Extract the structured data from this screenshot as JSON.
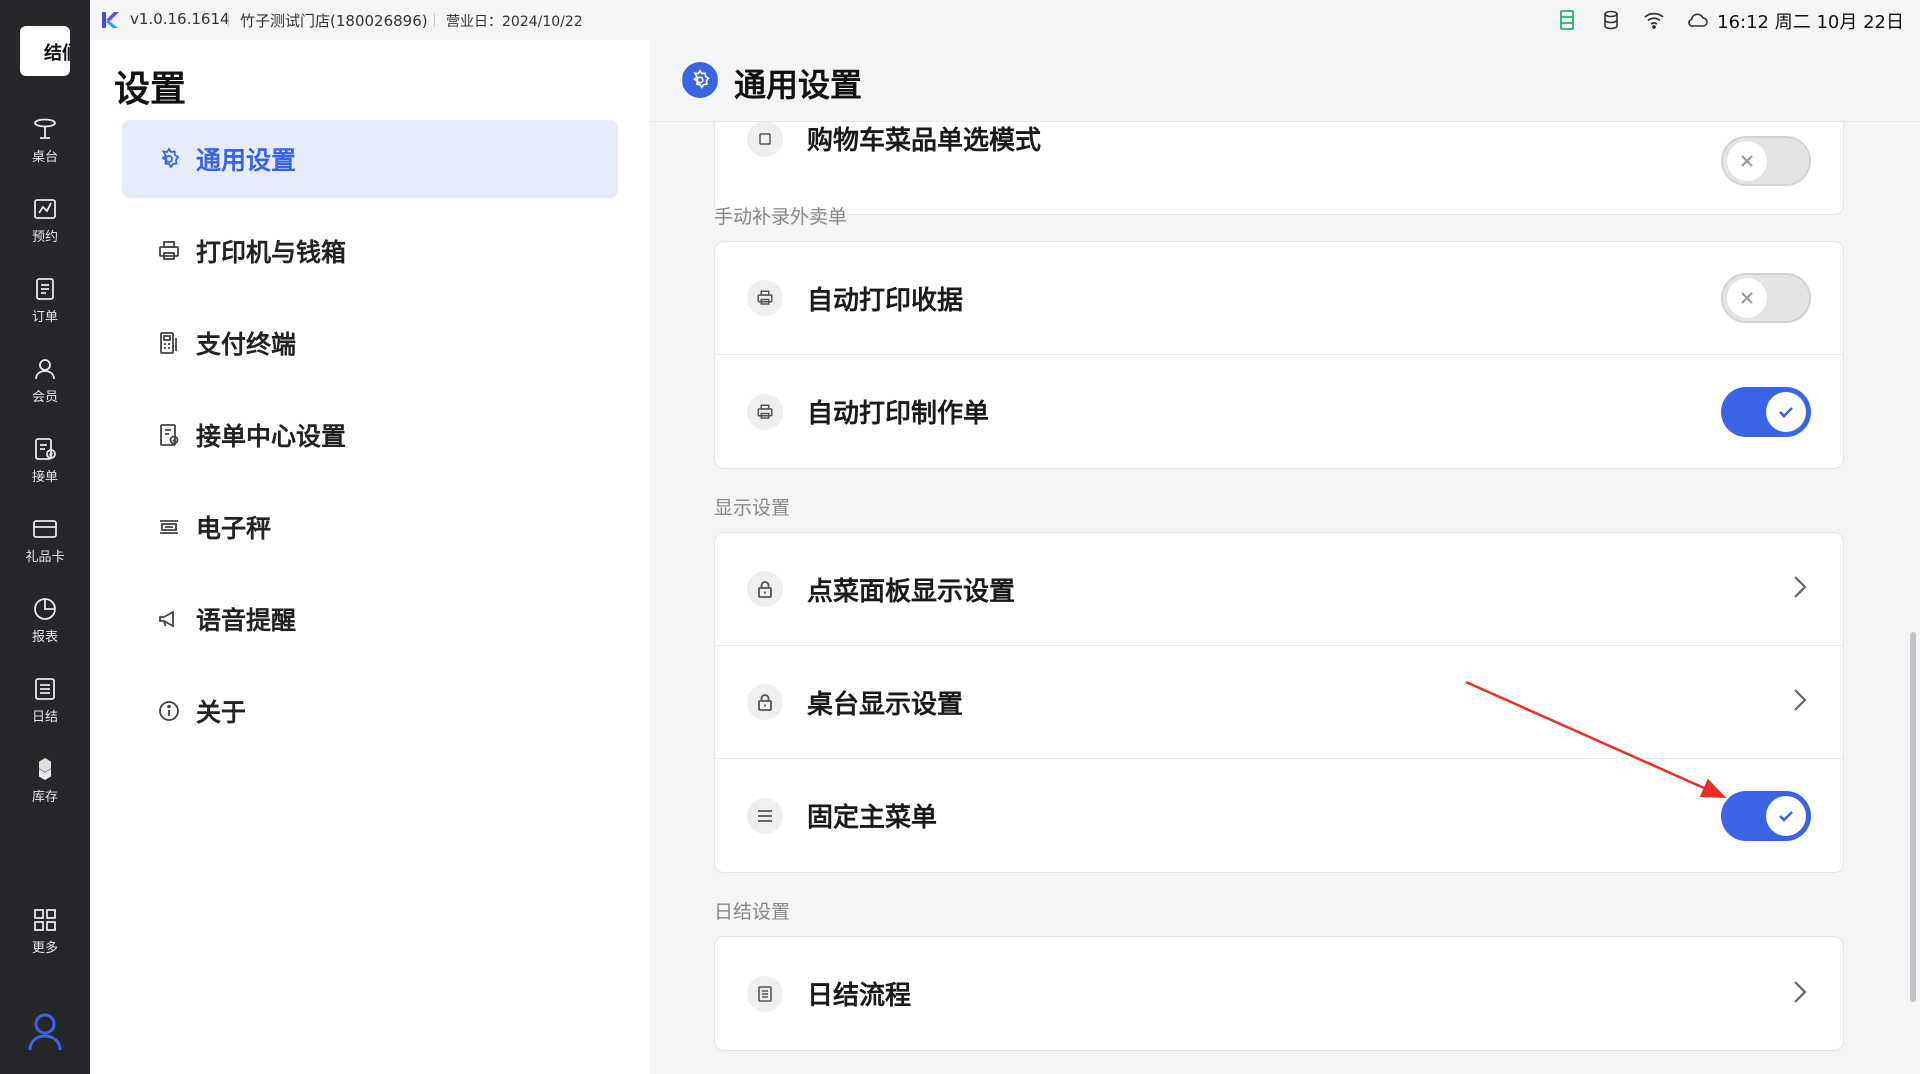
{
  "topbar": {
    "version": "v1.0.16.1614",
    "store": "竹子测试门店(180026896)",
    "business_date": "营业日：2024/10/22",
    "clock": "16:12 周二 10月 22日",
    "icons": [
      "ledger-icon",
      "database-icon",
      "wifi-icon",
      "cloud-icon"
    ],
    "accent_color": "#1fb56a"
  },
  "rail": {
    "logo_text": "结们",
    "items": [
      {
        "label": "桌台",
        "icon": "table-icon"
      },
      {
        "label": "预约",
        "icon": "reservation-icon"
      },
      {
        "label": "订单",
        "icon": "order-icon"
      },
      {
        "label": "会员",
        "icon": "member-icon"
      },
      {
        "label": "接单",
        "icon": "accept-order-icon"
      },
      {
        "label": "礼品卡",
        "icon": "gift-card-icon"
      },
      {
        "label": "报表",
        "icon": "report-icon"
      },
      {
        "label": "日结",
        "icon": "daily-close-icon"
      },
      {
        "label": "库存",
        "icon": "inventory-icon"
      },
      {
        "label": "更多",
        "icon": "more-icon"
      }
    ],
    "user_icon": "user-icon",
    "user_color": "#3b63e6"
  },
  "menu": {
    "title": "设置",
    "active_color": "#3b63e6",
    "items": [
      {
        "label": "通用设置",
        "icon": "gear-icon",
        "active": true
      },
      {
        "label": "打印机与钱箱",
        "icon": "printer-icon",
        "active": false
      },
      {
        "label": "支付终端",
        "icon": "pos-terminal-icon",
        "active": false
      },
      {
        "label": "接单中心设置",
        "icon": "order-center-icon",
        "active": false
      },
      {
        "label": "电子秤",
        "icon": "scale-icon",
        "active": false
      },
      {
        "label": "语音提醒",
        "icon": "megaphone-icon",
        "active": false
      },
      {
        "label": "关于",
        "icon": "info-icon",
        "active": false
      }
    ]
  },
  "content": {
    "title": "通用设置",
    "cut_row": {
      "label": "购物车菜品单选模式",
      "icon": "cart-icon",
      "toggle": "off"
    },
    "sections": [
      {
        "label": "手动补录外卖单",
        "rows": [
          {
            "label": "自动打印收据",
            "icon": "printer-icon",
            "control": "toggle",
            "state": "off"
          },
          {
            "label": "自动打印制作单",
            "icon": "printer-icon",
            "control": "toggle",
            "state": "on"
          }
        ]
      },
      {
        "label": "显示设置",
        "rows": [
          {
            "label": "点菜面板显示设置",
            "icon": "lock-icon",
            "control": "chevron"
          },
          {
            "label": "桌台显示设置",
            "icon": "lock-icon",
            "control": "chevron"
          },
          {
            "label": "固定主菜单",
            "icon": "menu-lines-icon",
            "control": "toggle",
            "state": "on"
          }
        ]
      },
      {
        "label": "日结设置",
        "rows": [
          {
            "label": "日结流程",
            "icon": "list-doc-icon",
            "control": "chevron"
          }
        ]
      }
    ]
  },
  "annotation": {
    "type": "arrow",
    "color": "#e8302a",
    "points_to": "固定主菜单 toggle"
  }
}
